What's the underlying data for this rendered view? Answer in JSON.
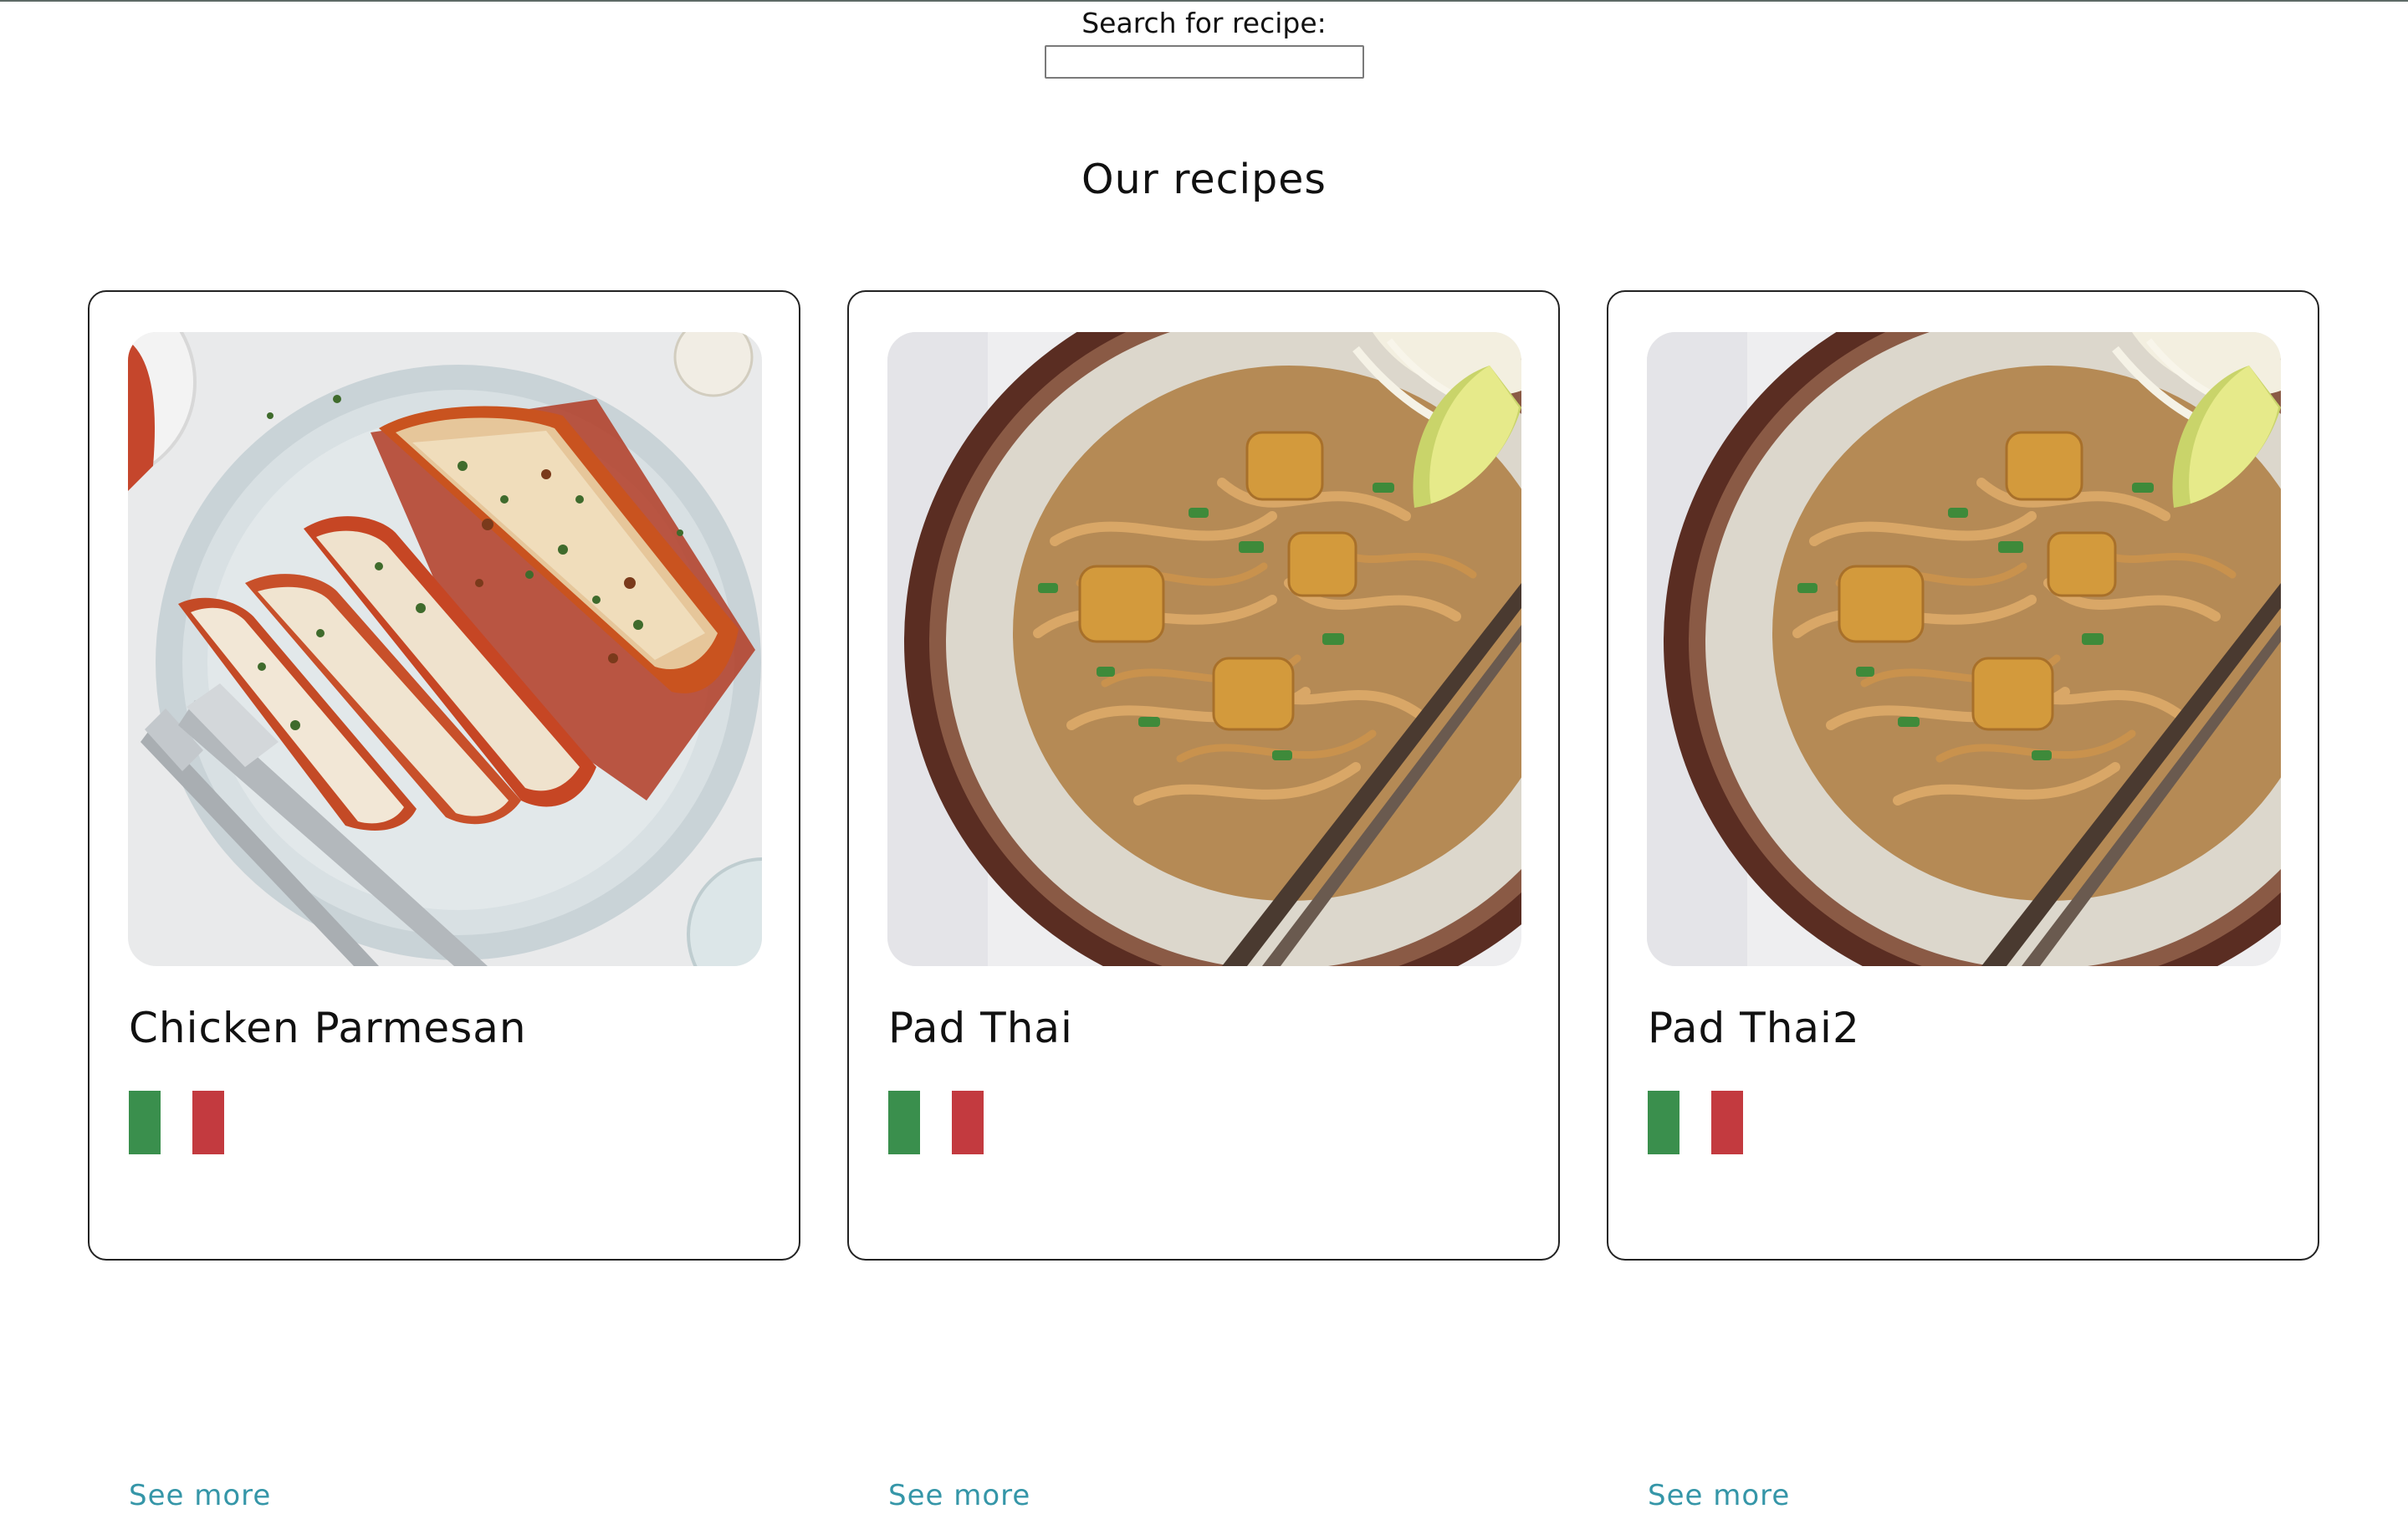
{
  "search": {
    "label": "Search for recipe:",
    "value": "",
    "placeholder": ""
  },
  "main": {
    "title": "Our recipes"
  },
  "recipes": [
    {
      "title": "Chicken Parmesan",
      "image_icon": "chicken-parmesan-photo",
      "flag_icon": "italian-flag-icon",
      "link_label": "See more"
    },
    {
      "title": "Pad Thai",
      "image_icon": "pad-thai-photo",
      "flag_icon": "italian-flag-icon",
      "link_label": "See more"
    },
    {
      "title": "Pad Thai2",
      "image_icon": "pad-thai-photo",
      "flag_icon": "italian-flag-icon",
      "link_label": "See more"
    }
  ],
  "colors": {
    "flag_green": "#3a8f4d",
    "flag_white": "#ffffff",
    "flag_red": "#c33a3f",
    "link": "#3596a8",
    "card_border": "#222222"
  }
}
